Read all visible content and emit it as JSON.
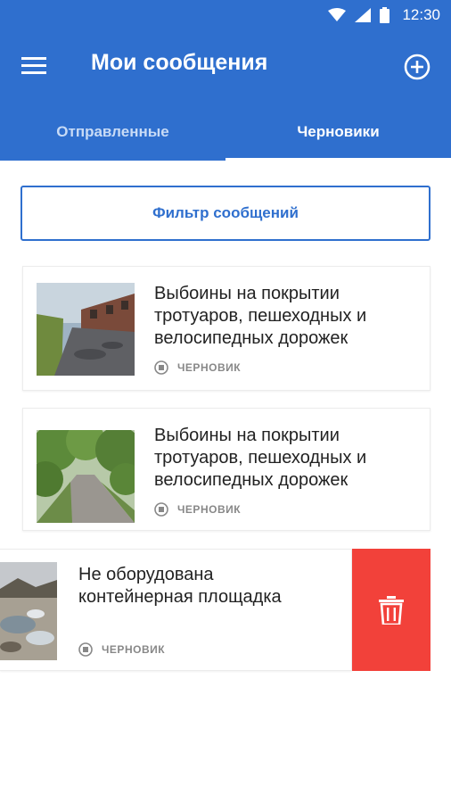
{
  "status_bar": {
    "time": "12:30"
  },
  "app_bar": {
    "title": "Мои сообщения"
  },
  "tabs": [
    {
      "label": "Отправленные",
      "active": false
    },
    {
      "label": "Черновики",
      "active": true
    }
  ],
  "filter": {
    "label": "Фильтр сообщений"
  },
  "messages": [
    {
      "title_lines": [
        "Выбоины на покрытии",
        "тротуаров, пешеходных и",
        "велосипедных дорожек"
      ],
      "status": "ЧЕРНОВИК"
    },
    {
      "title_lines": [
        "Выбоины на покрытии",
        "тротуаров, пешеходных и",
        "велосипедных дорожек"
      ],
      "status": "ЧЕРНОВИК"
    },
    {
      "title_lines": [
        "Не оборудована",
        "контейнерная площадка"
      ],
      "status": "ЧЕРНОВИК"
    }
  ],
  "colors": {
    "primary": "#2f6fce",
    "delete": "#f2413a",
    "muted": "#888888"
  },
  "icons": {
    "menu": "menu-icon",
    "add": "add-circle-icon",
    "draft": "draft-status-icon",
    "delete": "trash-icon"
  }
}
